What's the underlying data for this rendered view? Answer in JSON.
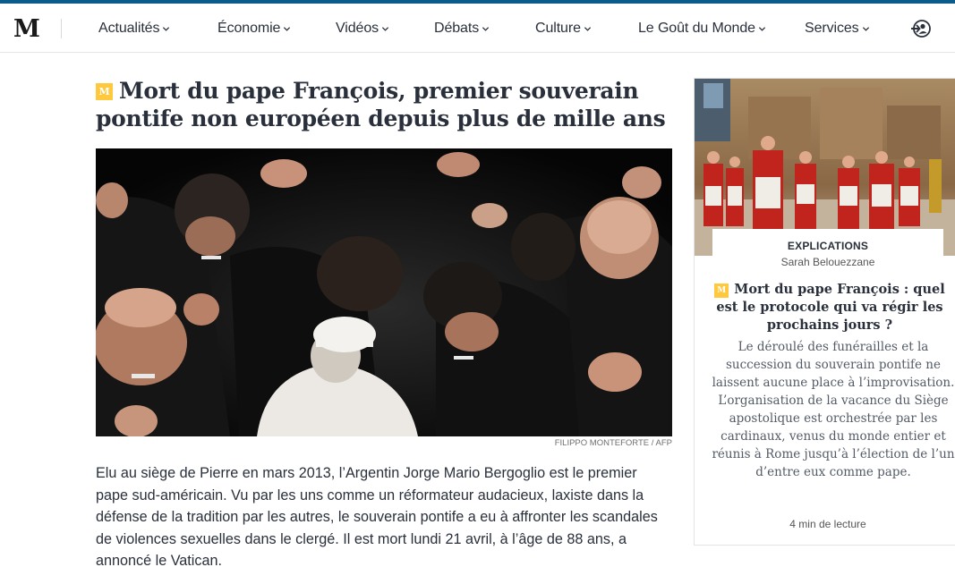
{
  "nav": {
    "items": [
      "Actualités",
      "Économie",
      "Vidéos",
      "Débats",
      "Culture",
      "Le Goût du Monde",
      "Services"
    ],
    "logo_glyph": "M",
    "icons": {
      "logo": "le-monde-logo",
      "chevron": "chevron-down-icon",
      "login": "login-icon"
    }
  },
  "article": {
    "badge": "M",
    "title": "Mort du pape François, premier souverain pontife non européen depuis plus de mille ans",
    "image_credit": "FILIPPO MONTEFORTE / AFP",
    "lead": "Elu au siège de Pierre en mars 2013, l’Argentin Jorge Mario Bergoglio est le premier pape sud-américain. Vu par les uns comme un réformateur audacieux, laxiste dans la défense de la tradition par les autres, le souverain pontife a eu à affronter les scandales de violences sexuelles dans le clergé. Il est mort lundi 21 avril, à l’âge de 88 ans, a annoncé le Vatican."
  },
  "sidebar_card": {
    "kicker": "EXPLICATIONS",
    "author": "Sarah Belouezzane",
    "badge": "M",
    "title": "Mort du pape François : quel est le protocole qui va régir les prochains jours ?",
    "description": "Le déroulé des funérailles et la succession du souverain pontife ne laissent aucune place à l’improvisation. L’organisation de la vacance du Siège apostolique est orchestrée par les cardinaux, venus du monde entier et réunis à Rome jusqu’à l’élection de l’un d’entre eux comme pape.",
    "reading_time": "4 min de lecture"
  },
  "colors": {
    "brand_blue": "#0b5c8a",
    "badge_yellow": "#ffc83d",
    "text": "#2a303b"
  }
}
